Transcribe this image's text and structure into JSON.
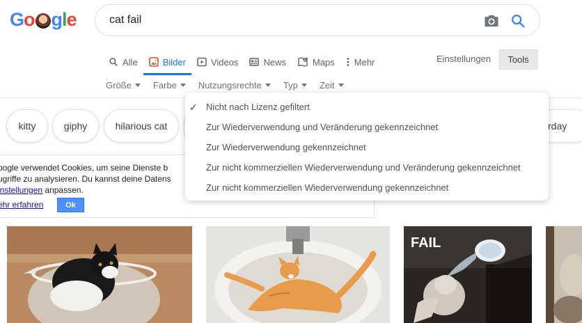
{
  "logo": {
    "letters": [
      "G",
      "o",
      "g",
      "l",
      "e"
    ]
  },
  "search": {
    "query": "cat fail"
  },
  "tabs": [
    {
      "label": "Alle",
      "icon": "search-icon",
      "active": false
    },
    {
      "label": "Bilder",
      "icon": "image-icon",
      "active": true
    },
    {
      "label": "Videos",
      "icon": "video-icon",
      "active": false
    },
    {
      "label": "News",
      "icon": "news-icon",
      "active": false
    },
    {
      "label": "Maps",
      "icon": "map-icon",
      "active": false
    },
    {
      "label": "Mehr",
      "icon": "more-vert-icon",
      "active": false
    }
  ],
  "settings_label": "Einstellungen",
  "tools_label": "Tools",
  "filters": [
    "Größe",
    "Farbe",
    "Nutzungsrechte",
    "Typ",
    "Zeit"
  ],
  "chips": [
    "kitty",
    "giphy",
    "hilarious cat",
    "rday"
  ],
  "cookie": {
    "line1": "oogle verwendet Cookies, um seine Dienste b",
    "line2": "ugriffe zu analysieren. Du kannst deine Datens",
    "line3_link": "instellungen",
    "line3_rest": " anpassen.",
    "more_link": "ehr erfahren",
    "ok_label": "Ok"
  },
  "dropdown": {
    "items": [
      {
        "label": "Nicht nach Lizenz gefiltert",
        "checked": true
      },
      {
        "label": "Zur Wiederverwendung und Veränderung gekennzeichnet",
        "checked": false
      },
      {
        "label": "Zur Wiederverwendung gekennzeichnet",
        "checked": false
      },
      {
        "label": "Zur nicht kommerziellen Wiederverwendung und Veränderung gekennzeichnet",
        "checked": false
      },
      {
        "label": "Zur nicht kommerziellen Wiederverwendung gekennzeichnet",
        "checked": false
      }
    ]
  },
  "images": [
    {
      "name": "cat-in-bowl"
    },
    {
      "name": "cat-in-sink"
    },
    {
      "name": "cat-fail-water",
      "caption": "FAIL"
    },
    {
      "name": "cat-partial"
    }
  ],
  "colors": {
    "accent": "#1a73e8",
    "ok_button": "#4d90fe",
    "link": "#1a0dab"
  }
}
